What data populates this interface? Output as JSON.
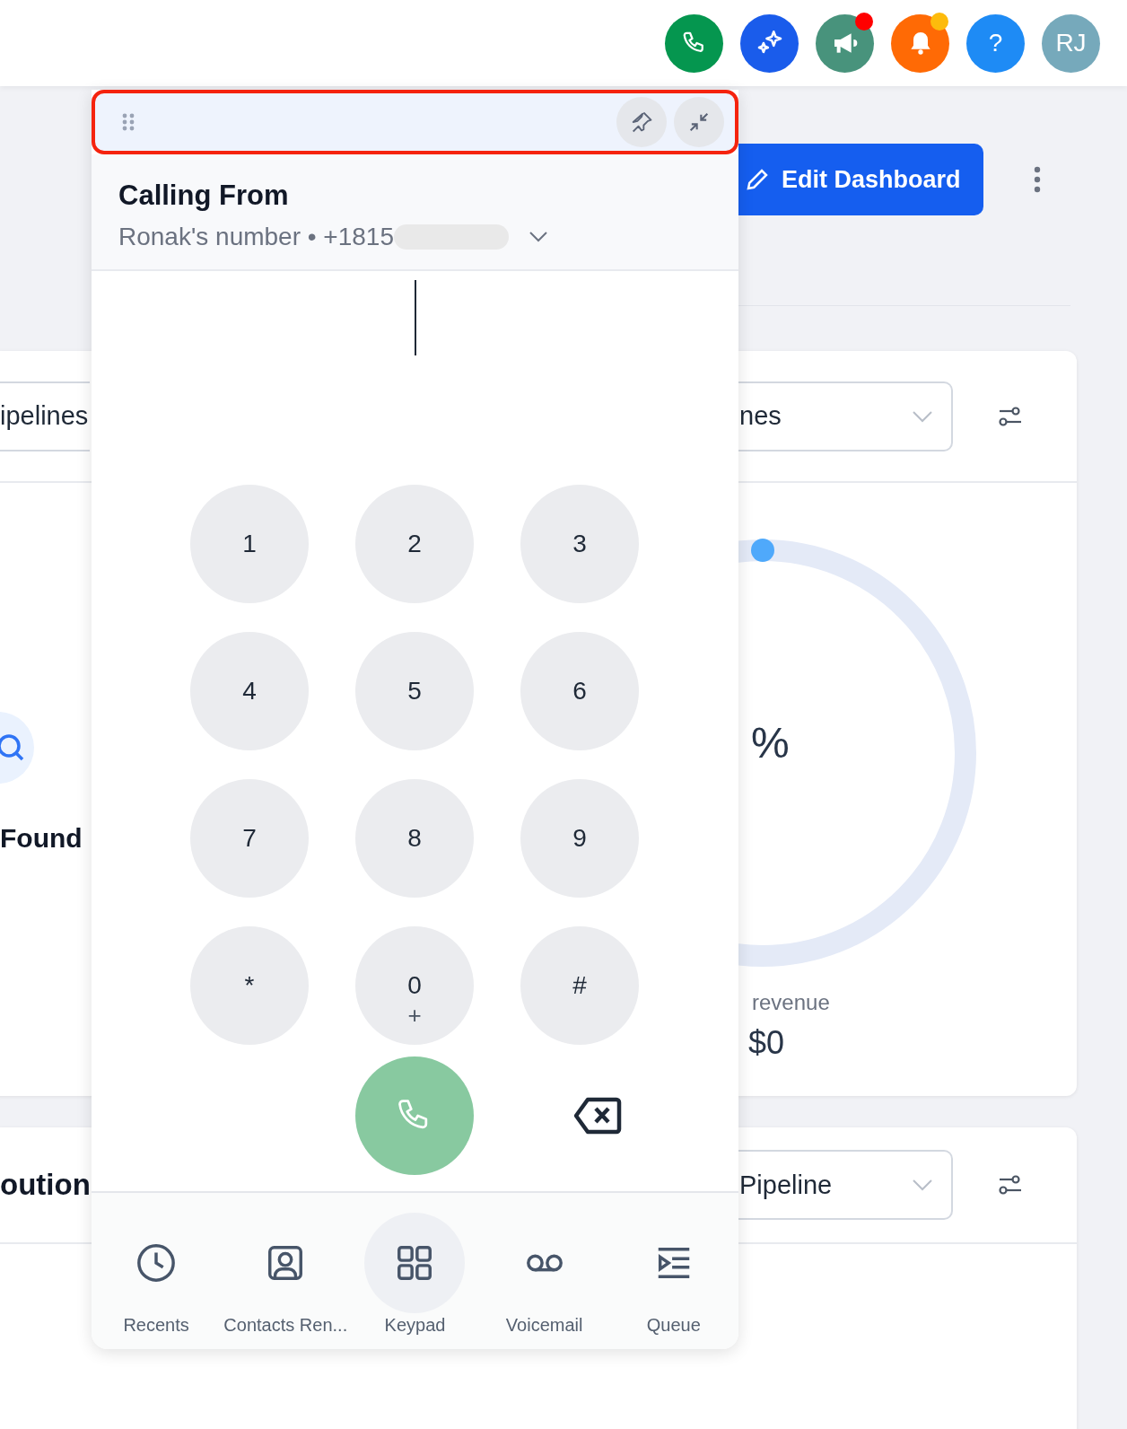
{
  "top_bar": {
    "icons": [
      {
        "kind": "phone",
        "color": "#05964f"
      },
      {
        "kind": "sparkles",
        "color": "#1a5ceb"
      },
      {
        "kind": "megaphone",
        "color": "#48937c",
        "badge": {
          "color": "#ff0000"
        }
      },
      {
        "kind": "bell",
        "color": "#ff6a05",
        "badge": {
          "color": "#fdbb0c"
        }
      },
      {
        "kind": "help",
        "color": "#1e8bf5",
        "text": "?"
      },
      {
        "kind": "avatar",
        "color": "#76a9bb",
        "text": "RJ"
      }
    ]
  },
  "toolbar": {
    "edit_button": "Edit Dashboard"
  },
  "card_1": {
    "left_dropdown": "ipelines",
    "right_dropdown": "nes",
    "empty_text": "Found",
    "percent": "%",
    "metric_label": "revenue",
    "metric_value": "$0"
  },
  "card_2": {
    "title": "oution",
    "dropdown": "Pipeline"
  },
  "dialer": {
    "calling_from": {
      "title": "Calling From",
      "number": "Ronak's number • +1815"
    },
    "keys": [
      {
        "label": "1"
      },
      {
        "label": "2"
      },
      {
        "label": "3"
      },
      {
        "label": "4"
      },
      {
        "label": "5"
      },
      {
        "label": "6"
      },
      {
        "label": "7"
      },
      {
        "label": "8"
      },
      {
        "label": "9"
      },
      {
        "label": "*"
      },
      {
        "label": "0",
        "sub": "+"
      },
      {
        "label": "#"
      }
    ],
    "nav": [
      {
        "kind": "recents",
        "label": "Recents",
        "selected": false
      },
      {
        "kind": "contacts",
        "label": "Contacts Ren...",
        "selected": false
      },
      {
        "kind": "keypad",
        "label": "Keypad",
        "selected": true
      },
      {
        "kind": "voicemail",
        "label": "Voicemail",
        "selected": false
      },
      {
        "kind": "queue",
        "label": "Queue",
        "selected": false
      }
    ]
  }
}
